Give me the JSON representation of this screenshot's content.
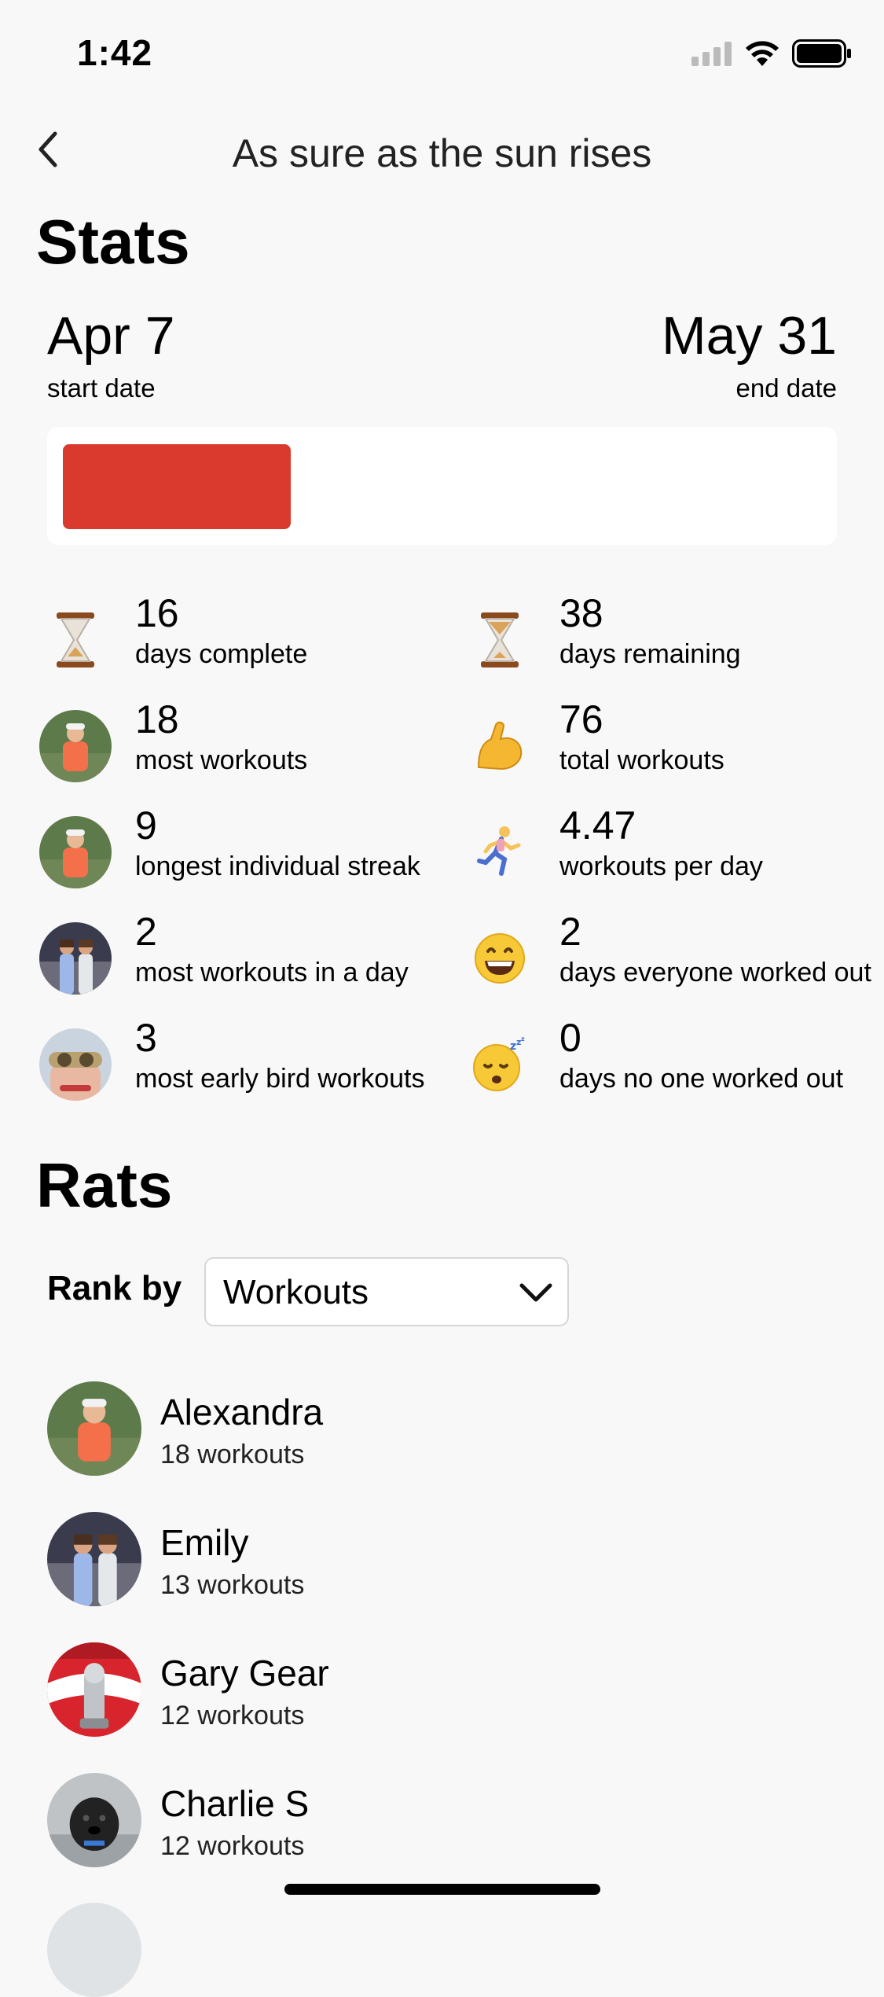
{
  "status_bar": {
    "time": "1:42"
  },
  "nav": {
    "title": "As sure as the sun rises"
  },
  "stats_section": {
    "title": "Stats",
    "start": {
      "value": "Apr 7",
      "label": "start date"
    },
    "end": {
      "value": "May 31",
      "label": "end date"
    },
    "progress_fraction": 0.3,
    "progress_color": "#d93a2d",
    "items": [
      {
        "value": "16",
        "label": "days complete",
        "icon": "hourglass-icon"
      },
      {
        "value": "38",
        "label": "days remaining",
        "icon": "hourglass-icon"
      },
      {
        "value": "18",
        "label": "most workouts",
        "icon": "avatar-alexandra"
      },
      {
        "value": "76",
        "label": "total workouts",
        "icon": "flexed-bicep-icon"
      },
      {
        "value": "9",
        "label": "longest individual streak",
        "icon": "avatar-alexandra"
      },
      {
        "value": "4.47",
        "label": "workouts per day",
        "icon": "runner-icon"
      },
      {
        "value": "2",
        "label": "most workouts in a day",
        "icon": "avatar-emily"
      },
      {
        "value": "2",
        "label": "days everyone worked out",
        "icon": "grinning-face-icon"
      },
      {
        "value": "3",
        "label": "most early bird workouts",
        "icon": "avatar-goggles"
      },
      {
        "value": "0",
        "label": "days no one worked out",
        "icon": "sleeping-face-icon"
      }
    ]
  },
  "rats_section": {
    "title": "Rats",
    "rank_by_label": "Rank by",
    "rank_by_value": "Workouts",
    "people": [
      {
        "name": "Alexandra",
        "sub": "18 workouts"
      },
      {
        "name": "Emily",
        "sub": "13 workouts"
      },
      {
        "name": "Gary Gear",
        "sub": "12 workouts"
      },
      {
        "name": "Charlie S",
        "sub": "12 workouts"
      }
    ]
  }
}
